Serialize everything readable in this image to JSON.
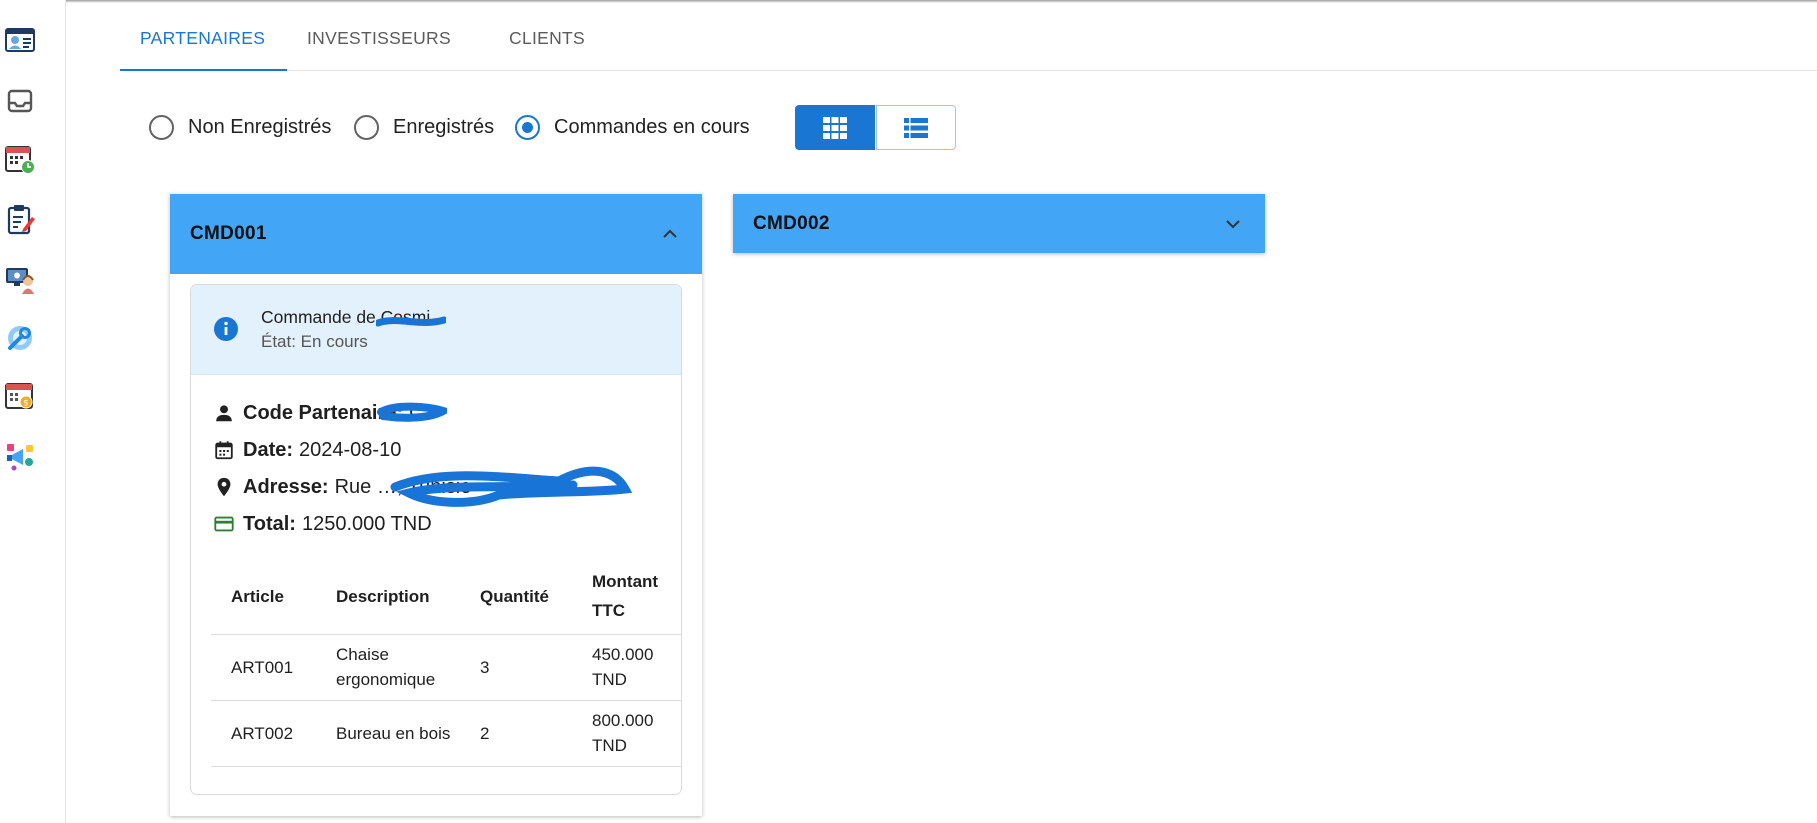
{
  "tabs": [
    {
      "label": "PARTENAIRES",
      "active": true
    },
    {
      "label": "INVESTISSEURS",
      "active": false
    },
    {
      "label": "CLIENTS",
      "active": false
    }
  ],
  "filters": {
    "options": [
      {
        "label": "Non Enregistrés",
        "checked": false
      },
      {
        "label": "Enregistrés",
        "checked": false
      },
      {
        "label": "Commandes en cours",
        "checked": true
      }
    ]
  },
  "view_toggle": {
    "active": "grid-view",
    "options": [
      "grid-view-icon",
      "list-view-icon"
    ]
  },
  "sidebar": {
    "icons": [
      "profile-card-icon",
      "inbox-icon",
      "calendar-clock-icon",
      "clipboard-edit-icon",
      "support-agent-icon",
      "settings-wrench-icon",
      "calendar-dollar-icon",
      "marketing-megaphone-icon"
    ]
  },
  "orders": [
    {
      "id": "CMD001",
      "expanded": true,
      "alert": {
        "title": "Commande de Cosmi",
        "status": "État: En cours"
      },
      "details": {
        "partner_label": "Code Partenaire:",
        "partner_value": "C",
        "date_label": "Date:",
        "date_value": "2024-08-10",
        "address_label": "Adresse:",
        "address_value": "Rue …, Tunisie",
        "total_label": "Total:",
        "total_value": "1250.000 TND"
      },
      "table": {
        "headers": [
          "Article",
          "Description",
          "Quantité",
          "Montant TTC"
        ],
        "rows": [
          [
            "ART001",
            "Chaise ergonomique",
            "3",
            "450.000 TND"
          ],
          [
            "ART002",
            "Bureau en bois",
            "2",
            "800.000 TND"
          ]
        ]
      }
    },
    {
      "id": "CMD002",
      "expanded": false
    }
  ],
  "colors": {
    "accent": "#1976d2",
    "card_header": "#42a5f5",
    "alert_bg": "#e3f1fd",
    "total_icon": "#2e7d32"
  }
}
